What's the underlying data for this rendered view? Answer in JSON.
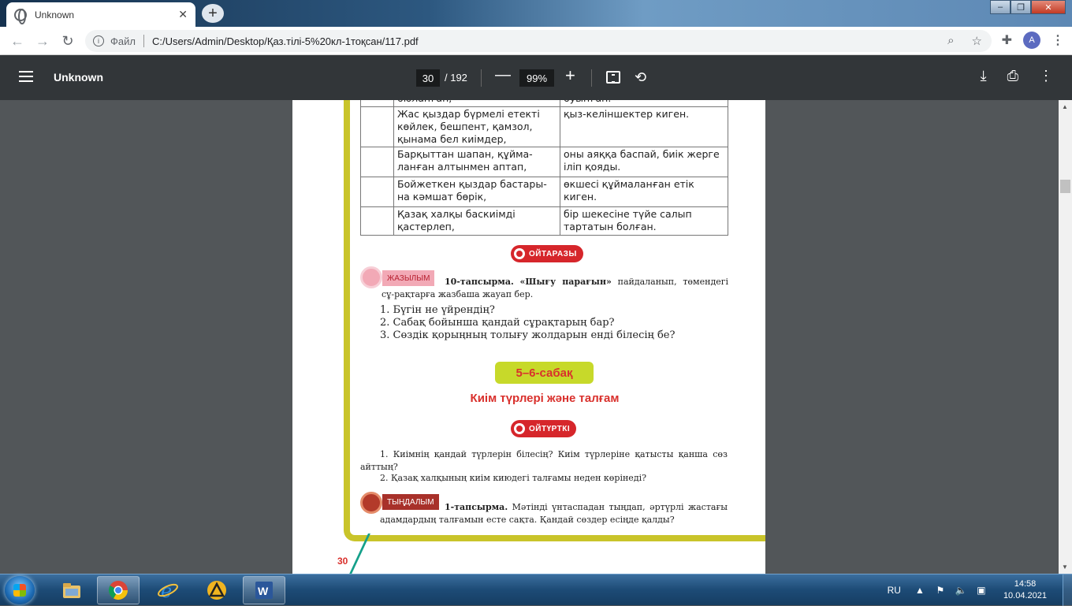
{
  "browser": {
    "tab_title": "Unknown",
    "new_tab": "+",
    "address_scheme": "Файл",
    "address_url": "C:/Users/Admin/Desktop/Қаз.тілі-5%20кл-1тоқсан/117.pdf",
    "profile_initial": "A"
  },
  "pdf_viewer": {
    "doc_title": "Unknown",
    "current_page": "30",
    "total_pages": "/ 192",
    "zoom": "99%"
  },
  "document": {
    "table_rows": [
      {
        "left": "бюланған,",
        "right": "буынған."
      },
      {
        "left": "Жас қыздар бүрмелі етекті көйлек, бешпент, қамзол, қынама бел киімдер,",
        "right": "қыз-келіншектер киген."
      },
      {
        "left": "Барқыттан шапан, құйма-ланған алтынмен аптап,",
        "right": "оны аяққа баспай, биік жерге іліп қояды."
      },
      {
        "left": "Бойжеткен қыздар бастары-на кәмшат бөрік,",
        "right": "өкшесі құймаланған етік киген."
      },
      {
        "left": "Қазақ халқы баскиімді қастерлеп,",
        "right": "бір шекесіне түйе салып тартатын болған."
      }
    ],
    "badge_oitarazy": "ОЙТАРАЗЫ",
    "section_writing_label": "ЖАЗЫЛЫМ",
    "task10_title": "10-тапсырма.",
    "task10_quote": "«Шығу парағын»",
    "task10_text": "пайдаланып, төмендегі сұ-рақтарға жазбаша жауап бер.",
    "questions": [
      "1. Бүгін не үйрендің?",
      "2. Сабақ бойынша қандай сұрақтарың бар?",
      "3. Сөздік қорыңның толығу жолдарын енді білесің бе?"
    ],
    "lesson_label": "5–6-сабақ",
    "lesson_title": "Киім түрлері және талғам",
    "badge_oiturtki": "ОЙТҮРТКІ",
    "prompt1": "1. Киімнің қандай түрлерін білесің? Киім түрлеріне қатысты қанша сөз айттың?",
    "prompt2": "2. Қазақ халқының киім киюдегі талғамы неден көрінеді?",
    "section_listening_label": "ТЫҢДАЛЫМ",
    "task1_title": "1-тапсырма.",
    "task1_text": "Мәтінді үнтаспадан тыңдап, әртүрлі жастағы адамдардың талғамын есте сақта. Қандай сөздер есіңде қалды?",
    "page_number": "30"
  },
  "taskbar": {
    "language": "RU",
    "time": "14:58",
    "date": "10.04.2021"
  },
  "colors": {
    "accent_red": "#d6262b",
    "lesson_green": "#c7d92a",
    "frame_yellow": "#c9c42a"
  }
}
